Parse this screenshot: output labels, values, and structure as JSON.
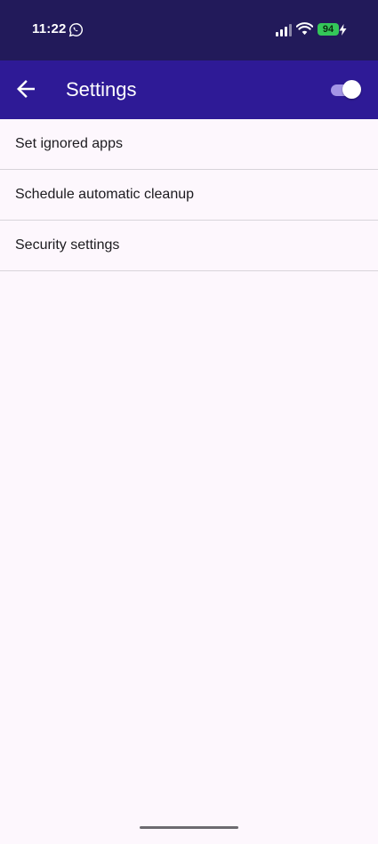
{
  "status_bar": {
    "time": "11:22",
    "battery_level": "94",
    "icons": [
      "whatsapp-icon",
      "signal-icon",
      "wifi-icon",
      "battery-icon",
      "charging-bolt-icon"
    ]
  },
  "app_bar": {
    "title": "Settings",
    "back_icon": "arrow-left-icon",
    "toggle_state": "on",
    "colors": {
      "app_bar": "#2e1a96",
      "status_bar": "#221a5a",
      "toggle_track": "#a495e6"
    }
  },
  "settings": {
    "items": [
      {
        "label": "Set ignored apps"
      },
      {
        "label": "Schedule automatic cleanup"
      },
      {
        "label": "Security settings"
      }
    ]
  }
}
